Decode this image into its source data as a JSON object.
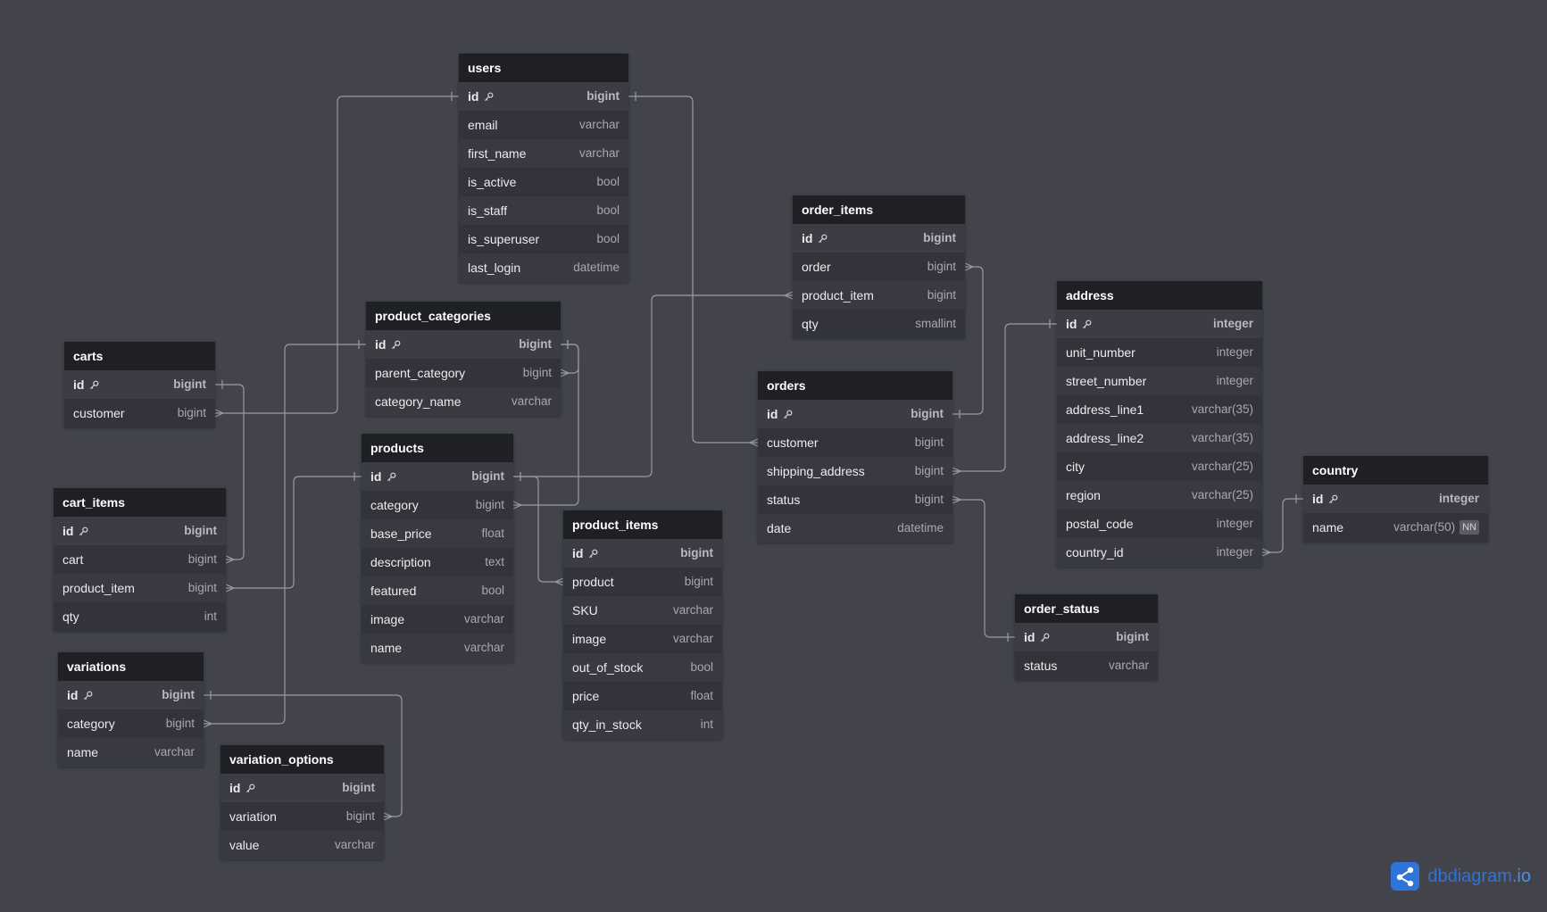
{
  "brand": {
    "name": "dbdiagram",
    "suffix": ".io"
  },
  "colors": {
    "background": "#42434b",
    "table_body": "#33343b",
    "table_header": "#1f2024",
    "connector": "#9a9aa2",
    "brand": "#2f74d8"
  },
  "tables": [
    {
      "id": "users",
      "name": "users",
      "fields": [
        {
          "name": "id",
          "type": "bigint",
          "pk": true
        },
        {
          "name": "email",
          "type": "varchar"
        },
        {
          "name": "first_name",
          "type": "varchar"
        },
        {
          "name": "is_active",
          "type": "bool"
        },
        {
          "name": "is_staff",
          "type": "bool"
        },
        {
          "name": "is_superuser",
          "type": "bool"
        },
        {
          "name": "last_login",
          "type": "datetime"
        }
      ]
    },
    {
      "id": "order_items",
      "name": "order_items",
      "fields": [
        {
          "name": "id",
          "type": "bigint",
          "pk": true
        },
        {
          "name": "order",
          "type": "bigint"
        },
        {
          "name": "product_item",
          "type": "bigint"
        },
        {
          "name": "qty",
          "type": "smallint"
        }
      ]
    },
    {
      "id": "address",
      "name": "address",
      "fields": [
        {
          "name": "id",
          "type": "integer",
          "pk": true
        },
        {
          "name": "unit_number",
          "type": "integer"
        },
        {
          "name": "street_number",
          "type": "integer"
        },
        {
          "name": "address_line1",
          "type": "varchar(35)"
        },
        {
          "name": "address_line2",
          "type": "varchar(35)"
        },
        {
          "name": "city",
          "type": "varchar(25)"
        },
        {
          "name": "region",
          "type": "varchar(25)"
        },
        {
          "name": "postal_code",
          "type": "integer"
        },
        {
          "name": "country_id",
          "type": "integer"
        }
      ]
    },
    {
      "id": "product_categories",
      "name": "product_categories",
      "fields": [
        {
          "name": "id",
          "type": "bigint",
          "pk": true
        },
        {
          "name": "parent_category",
          "type": "bigint"
        },
        {
          "name": "category_name",
          "type": "varchar"
        }
      ]
    },
    {
      "id": "carts",
      "name": "carts",
      "fields": [
        {
          "name": "id",
          "type": "bigint",
          "pk": true
        },
        {
          "name": "customer",
          "type": "bigint"
        }
      ]
    },
    {
      "id": "orders",
      "name": "orders",
      "fields": [
        {
          "name": "id",
          "type": "bigint",
          "pk": true
        },
        {
          "name": "customer",
          "type": "bigint"
        },
        {
          "name": "shipping_address",
          "type": "bigint"
        },
        {
          "name": "status",
          "type": "bigint"
        },
        {
          "name": "date",
          "type": "datetime"
        }
      ]
    },
    {
      "id": "products",
      "name": "products",
      "fields": [
        {
          "name": "id",
          "type": "bigint",
          "pk": true
        },
        {
          "name": "category",
          "type": "bigint"
        },
        {
          "name": "base_price",
          "type": "float"
        },
        {
          "name": "description",
          "type": "text"
        },
        {
          "name": "featured",
          "type": "bool"
        },
        {
          "name": "image",
          "type": "varchar"
        },
        {
          "name": "name",
          "type": "varchar"
        }
      ]
    },
    {
      "id": "country",
      "name": "country",
      "fields": [
        {
          "name": "id",
          "type": "integer",
          "pk": true
        },
        {
          "name": "name",
          "type": "varchar(50)",
          "badge": "NN"
        }
      ]
    },
    {
      "id": "cart_items",
      "name": "cart_items",
      "fields": [
        {
          "name": "id",
          "type": "bigint",
          "pk": true
        },
        {
          "name": "cart",
          "type": "bigint"
        },
        {
          "name": "product_item",
          "type": "bigint"
        },
        {
          "name": "qty",
          "type": "int"
        }
      ]
    },
    {
      "id": "product_items",
      "name": "product_items",
      "fields": [
        {
          "name": "id",
          "type": "bigint",
          "pk": true
        },
        {
          "name": "product",
          "type": "bigint"
        },
        {
          "name": "SKU",
          "type": "varchar"
        },
        {
          "name": "image",
          "type": "varchar"
        },
        {
          "name": "out_of_stock",
          "type": "bool"
        },
        {
          "name": "price",
          "type": "float"
        },
        {
          "name": "qty_in_stock",
          "type": "int"
        }
      ]
    },
    {
      "id": "order_status",
      "name": "order_status",
      "fields": [
        {
          "name": "id",
          "type": "bigint",
          "pk": true
        },
        {
          "name": "status",
          "type": "varchar"
        }
      ]
    },
    {
      "id": "variations",
      "name": "variations",
      "fields": [
        {
          "name": "id",
          "type": "bigint",
          "pk": true
        },
        {
          "name": "category",
          "type": "bigint"
        },
        {
          "name": "name",
          "type": "varchar"
        }
      ]
    },
    {
      "id": "variation_options",
      "name": "variation_options",
      "fields": [
        {
          "name": "id",
          "type": "bigint",
          "pk": true
        },
        {
          "name": "variation",
          "type": "bigint"
        },
        {
          "name": "value",
          "type": "varchar"
        }
      ]
    }
  ],
  "relationships": [
    {
      "from": "carts.customer",
      "to": "users.id"
    },
    {
      "from": "orders.customer",
      "to": "users.id"
    },
    {
      "from": "order_items.order",
      "to": "orders.id"
    },
    {
      "from": "order_items.product_item",
      "to": "products.id"
    },
    {
      "from": "orders.shipping_address",
      "to": "address.id"
    },
    {
      "from": "orders.status",
      "to": "order_status.id"
    },
    {
      "from": "address.country_id",
      "to": "country.id"
    },
    {
      "from": "product_categories.parent_category",
      "to": "product_categories.id"
    },
    {
      "from": "products.category",
      "to": "product_categories.id"
    },
    {
      "from": "cart_items.cart",
      "to": "carts.id"
    },
    {
      "from": "cart_items.product_item",
      "to": "products.id"
    },
    {
      "from": "product_items.product",
      "to": "products.id"
    },
    {
      "from": "variations.category",
      "to": "product_categories.id"
    },
    {
      "from": "variation_options.variation",
      "to": "variations.id"
    }
  ]
}
